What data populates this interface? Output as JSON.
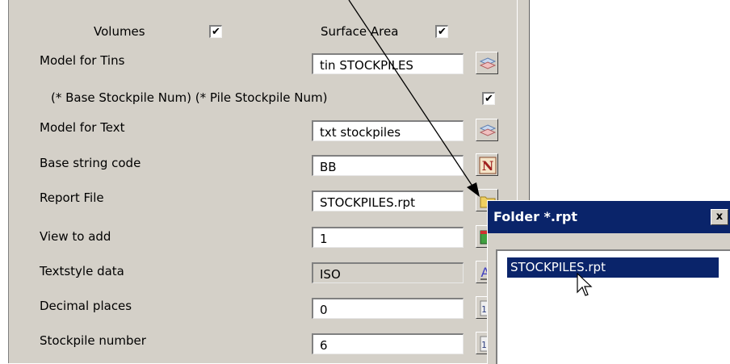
{
  "panel": {
    "volumes_label": "Volumes",
    "volumes_checked": "✔",
    "surface_area_label": "Surface Area",
    "surface_area_checked": "✔",
    "model_tins_label": "Model for Tins",
    "model_tins_value": "tin STOCKPILES",
    "stockpile_num_label": "(* Base Stockpile Num)  (* Pile Stockpile Num)",
    "stockpile_num_checked": "✔",
    "model_text_label": "Model for Text",
    "model_text_value": "txt stockpiles",
    "base_string_label": "Base string code",
    "base_string_value": "BB",
    "report_file_label": "Report File",
    "report_file_value": "STOCKPILES.rpt",
    "view_label": "View to add",
    "view_value": "1",
    "textstyle_label": "Textstyle data",
    "textstyle_value": "ISO",
    "decimal_label": "Decimal places",
    "decimal_value": "0",
    "stockpile_number_label": "Stockpile number",
    "stockpile_number_value": "6"
  },
  "dialog": {
    "title": "Folder *.rpt",
    "close": "x",
    "items": [
      "STOCKPILES.rpt"
    ]
  },
  "icons": {
    "models": "layers-icon",
    "string_code": "n-letter-icon",
    "folder": "folder-icon",
    "view": "view-icon",
    "textstyle": "textstyle-icon",
    "number": "number-spinner-icon"
  },
  "colors": {
    "panel_bg": "#d4d0c8",
    "title_bar": "#0a246a",
    "selection": "#0a246a"
  }
}
